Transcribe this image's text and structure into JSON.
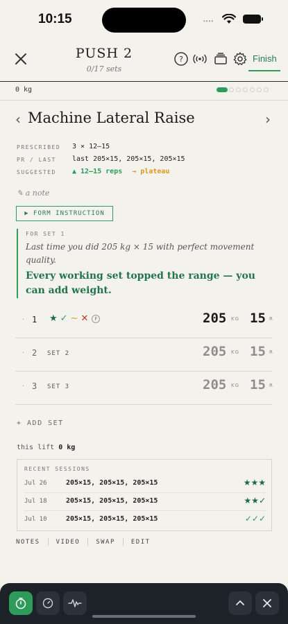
{
  "status_bar": {
    "time": "10:15",
    "dots": "••••"
  },
  "header": {
    "title": "PUSH 2",
    "subtitle": "0/17 sets",
    "finish_label": "Finish",
    "icons": [
      "close-icon",
      "help-icon",
      "broadcast-icon",
      "stack-icon",
      "settings-icon"
    ]
  },
  "weight_bar": {
    "value": "0 kg",
    "progress_total": 7,
    "progress_current": 1
  },
  "exercise": {
    "name": "Machine Lateral Raise",
    "prescribed_label": "PRESCRIBED",
    "prescribed": "3 × 12–15",
    "pr_label": "PR / LAST",
    "pr_last": "last 205×15, 205×15, 205×15",
    "suggested_label": "SUGGESTED",
    "suggested_reps": "▲ 12–15 reps",
    "suggested_trend": "→ plateau",
    "note_placeholder": "✎ a note",
    "form_button": "▶ FORM INSTRUCTION"
  },
  "coach": {
    "label": "FOR SET 1",
    "last_time": "Last time you did 205 kg × 15 with perfect movement quality.",
    "advice": "Every working set topped the range — you can add weight."
  },
  "sets": [
    {
      "num": "1",
      "label": "",
      "weight": "205",
      "unit_kg": "KG",
      "reps": "15",
      "unit_r": "R",
      "active": true
    },
    {
      "num": "2",
      "label": "SET 2",
      "weight": "205",
      "unit_kg": "KG",
      "reps": "15",
      "unit_r": "R",
      "active": false
    },
    {
      "num": "3",
      "label": "SET 3",
      "weight": "205",
      "unit_kg": "KG",
      "reps": "15",
      "unit_r": "R",
      "active": false
    }
  ],
  "set1_rating": {
    "star": "★",
    "check": "✓",
    "tilde": "~",
    "x": "✕",
    "f": "F"
  },
  "add_set": "+ ADD SET",
  "this_lift": {
    "label": "this lift",
    "value": "0 kg"
  },
  "recent": {
    "label": "RECENT SESSIONS",
    "rows": [
      {
        "date": "Jul 26",
        "sets": "205×15, 205×15, 205×15",
        "rating": "★★★"
      },
      {
        "date": "Jul 18",
        "sets": "205×15, 205×15, 205×15",
        "rating": "★★✓"
      },
      {
        "date": "Jul 10",
        "sets": "205×15, 205×15, 205×15",
        "rating": "✓✓✓"
      }
    ]
  },
  "tabs": [
    "NOTES",
    "VIDEO",
    "SWAP",
    "EDIT"
  ],
  "colors": {
    "accent": "#2e9b5b",
    "warning": "#d99a1f",
    "danger": "#c0392b",
    "bar_bg": "#1d2128"
  }
}
